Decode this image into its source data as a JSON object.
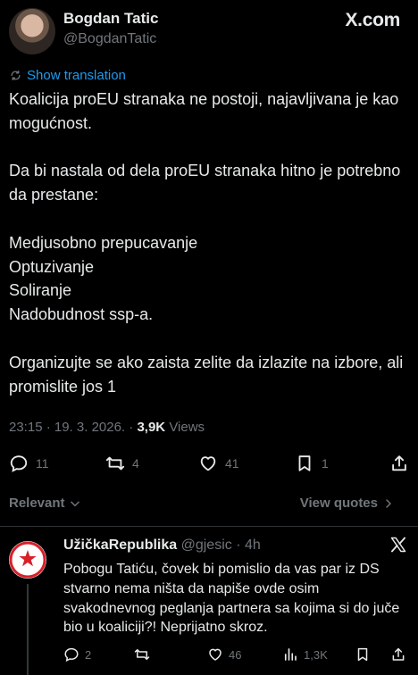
{
  "tweet": {
    "author_name": "Bogdan Tatic",
    "author_handle": "@BogdanTatic",
    "brand": "X.com",
    "show_translation": "Show translation",
    "paragraphs": [
      "Koalicija proEU stranaka ne postoji, najavljivana je kao mogućnost.",
      "Da bi nastala od dela proEU stranaka hitno je potrebno da prestane:",
      "Medjusobno prepucavanje\nOptuzivanje\nSoliranje\nNadobudnost ssp-a.",
      "Organizujte se ako zaista zelite da izlazite na izbore, ali promislite jos 1"
    ],
    "timestamp": "23:15 · 19. 3. 2026.",
    "meta_separator": " · ",
    "views_count": "3,9K",
    "views_label": "Views",
    "replies": "11",
    "reposts": "4",
    "likes": "41",
    "bookmarks": "1"
  },
  "sort": {
    "relevant_label": "Relevant",
    "view_quotes_label": "View quotes"
  },
  "reply": {
    "author_name": "UžičkaRepublika",
    "author_handle": "@gjesic",
    "time": "4h",
    "avatar_text_top": "УЖИЧКА",
    "avatar_text_bottom": "РЕПУБЛИКА",
    "text": "Pobogu Tatiću, čovek bi pomislio da vas par iz DS stvarno nema ništa da napiše ovde osim svakodnevnog peglanja partnera sa kojima si do juče bio u koaliciji?!  Neprijatno skroz.",
    "replies": "2",
    "reposts": "",
    "likes": "46",
    "views": "1,3K"
  },
  "colors": {
    "background": "#000000",
    "text": "#e7e9ea",
    "muted": "#71767b",
    "link": "#1d9bf0",
    "divider": "#2f3336",
    "avatar_red": "#d8202a"
  },
  "icons": [
    "translate-icon",
    "reply-icon",
    "repost-icon",
    "like-icon",
    "bookmark-icon",
    "share-icon",
    "chevron-down-icon",
    "chevron-right-icon",
    "x-logo-icon",
    "views-icon"
  ]
}
